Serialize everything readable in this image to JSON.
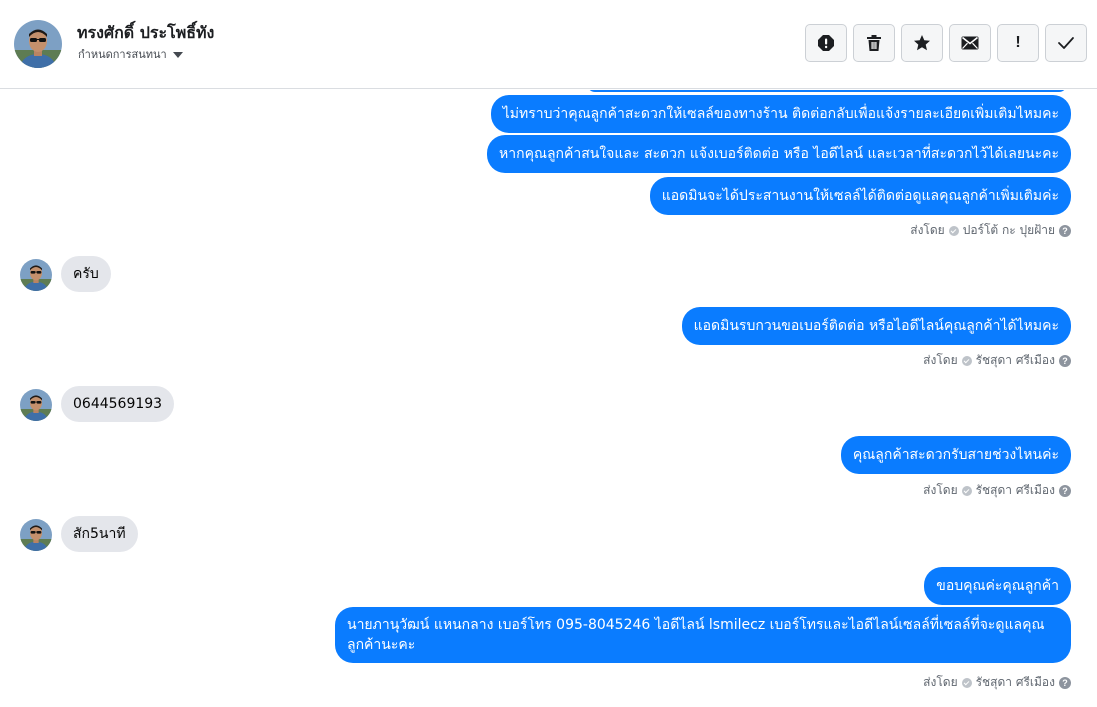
{
  "header": {
    "contact_name": "ทรงศักดิ์ ประโพธิ์ทัง",
    "assign_label": "กำหนดการสนทนา"
  },
  "toolbar": {
    "icons": [
      "spam-icon",
      "trash-icon",
      "star-icon",
      "envelope-icon",
      "exclamation-icon",
      "checkmark-icon"
    ],
    "exclamation_text": "!"
  },
  "messages": [
    {
      "direction": "out",
      "text": "ไม่ทราบว่าคุณลูกค้าสะดวกให้เซลล์ของทางร้าน ติดต่อกลับเพื่อแจ้งรายละเอียดเพิ่มเติมไหมคะ"
    },
    {
      "direction": "out",
      "text": "หากคุณลูกค้าสนใจและ สะดวก แจ้งเบอร์ติดต่อ หรือ ไอดีไลน์ และเวลาที่สะดวกไว้ได้เลยนะคะ"
    },
    {
      "direction": "out",
      "text": "แอดมินจะได้ประสานงานให้เซลล์ได้ติดต่อดูแลคุณลูกค้าเพิ่มเติมค่ะ"
    },
    {
      "direction": "in",
      "text": "ครับ"
    },
    {
      "direction": "out",
      "text": "แอดมินรบกวนขอเบอร์ติดต่อ หรือไอดีไลน์คุณลูกค้าได้ไหมคะ"
    },
    {
      "direction": "in",
      "text": "0644569193"
    },
    {
      "direction": "out",
      "text": "คุณลูกค้าสะดวกรับสายช่วงไหนค่ะ"
    },
    {
      "direction": "in",
      "text": "สัก5นาที"
    },
    {
      "direction": "out",
      "text": "ขอบคุณค่ะคุณลูกค้า"
    },
    {
      "direction": "out",
      "text": "นายภานุวัฒน์ แหนกลาง เบอร์โทร 095-8045246 ไอดีไลน์ lsmilecz  เบอร์โทรและไอดีไลน์เซลล์ที่เซลล์ที่จะดูแลคุณลูกค้านะคะ"
    }
  ],
  "senders": [
    {
      "label": "ส่งโดย",
      "name": "ปอร์โต้ กะ ปุยฝ้าย"
    },
    {
      "label": "ส่งโดย",
      "name": "รัชสุดา ศรีเมือง"
    },
    {
      "label": "ส่งโดย",
      "name": "รัชสุดา ศรีเมือง"
    },
    {
      "label": "ส่งโดย",
      "name": "รัชสุดา ศรีเมือง"
    }
  ],
  "help_glyph": "?",
  "colors": {
    "outgoing_bubble": "#0a7cff",
    "incoming_bubble": "#e4e6eb",
    "meta_text": "#606770"
  }
}
